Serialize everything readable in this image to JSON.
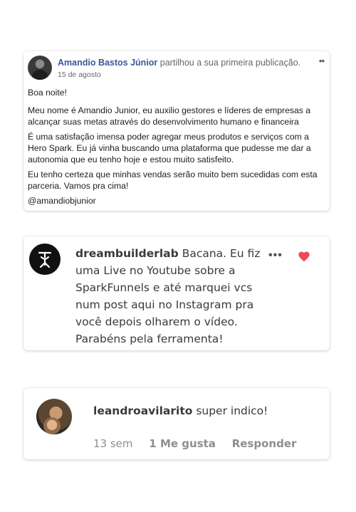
{
  "fb_post": {
    "author": "Amandio Bastos Júnior",
    "action": "partilhou a sua primeira publicação.",
    "date": "15 de agosto",
    "more_icon": "more-dots-icon",
    "paragraphs": [
      "Boa noite!",
      "Meu nome é Amandio Junior, eu auxilio gestores e líderes de empresas a alcançar suas metas através do desenvolvimento humano e financeira",
      "É uma satisfação imensa poder agregar meus produtos e serviços com a Hero Spark. Eu já vinha buscando uma plataforma que pudesse me dar a autonomia que eu tenho hoje e estou muito satisfeito.",
      "Eu tenho certeza que minhas vendas serão muito bem sucedidas com esta parceria. Vamos pra cima!",
      "@amandiobjunior"
    ]
  },
  "ig_comment_1": {
    "username": "dreambuilderlab",
    "text": "Bacana. Eu fiz uma Live no Youtube sobre a SparkFunnels e até marquei vcs num post aqui no Instagram pra você depois olharem o vídeo. Parabéns pela ferramenta!",
    "dots": "•••",
    "heart_color": "#ed4956"
  },
  "ig_comment_2": {
    "username": "leandroavilarito",
    "text": "super indico!",
    "time": "13 sem",
    "likes": "1 Me gusta",
    "reply": "Responder"
  }
}
